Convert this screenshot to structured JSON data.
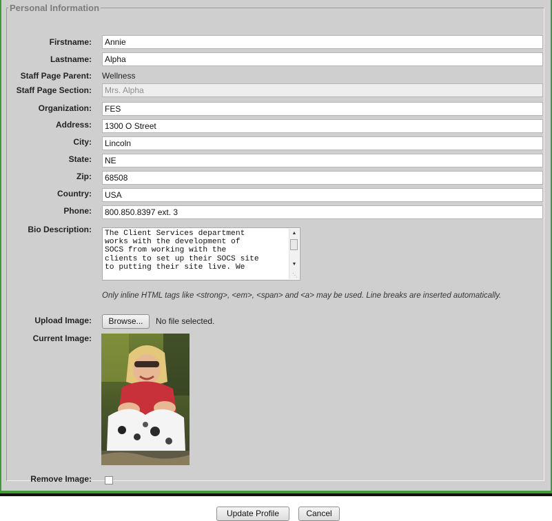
{
  "fieldset": {
    "legend": "Personal Information"
  },
  "fields": {
    "firstname": {
      "label": "Firstname:",
      "value": "Annie"
    },
    "lastname": {
      "label": "Lastname:",
      "value": "Alpha"
    },
    "staff_page_parent": {
      "label": "Staff Page Parent:",
      "value": "Wellness"
    },
    "staff_page_section": {
      "label": "Staff Page Section:",
      "value": "Mrs. Alpha"
    },
    "organization": {
      "label": "Organization:",
      "value": "FES"
    },
    "address": {
      "label": "Address:",
      "value": "1300 O Street"
    },
    "city": {
      "label": "City:",
      "value": "Lincoln"
    },
    "state": {
      "label": "State:",
      "value": "NE"
    },
    "zip": {
      "label": "Zip:",
      "value": "68508"
    },
    "country": {
      "label": "Country:",
      "value": "USA"
    },
    "phone": {
      "label": "Phone:",
      "value": "800.850.8397 ext. 3"
    }
  },
  "bio": {
    "label": "Bio Description:",
    "value": "The Client Services department\nworks with the development of\nSOCS from working with the\nclients to set up their SOCS site\nto putting their site live. We",
    "note": "Only inline HTML tags like <strong>, <em>, <span> and <a> may be used. Line breaks are inserted automatically."
  },
  "upload": {
    "label": "Upload Image:",
    "browse_label": "Browse...",
    "status": "No file selected."
  },
  "current_image": {
    "label": "Current Image:"
  },
  "remove_image": {
    "label": "Remove Image:",
    "checked": false
  },
  "actions": {
    "update_label": "Update Profile",
    "cancel_label": "Cancel"
  },
  "colors": {
    "frame_border": "#3f9a3f",
    "panel_bg": "#cfcfcf"
  }
}
